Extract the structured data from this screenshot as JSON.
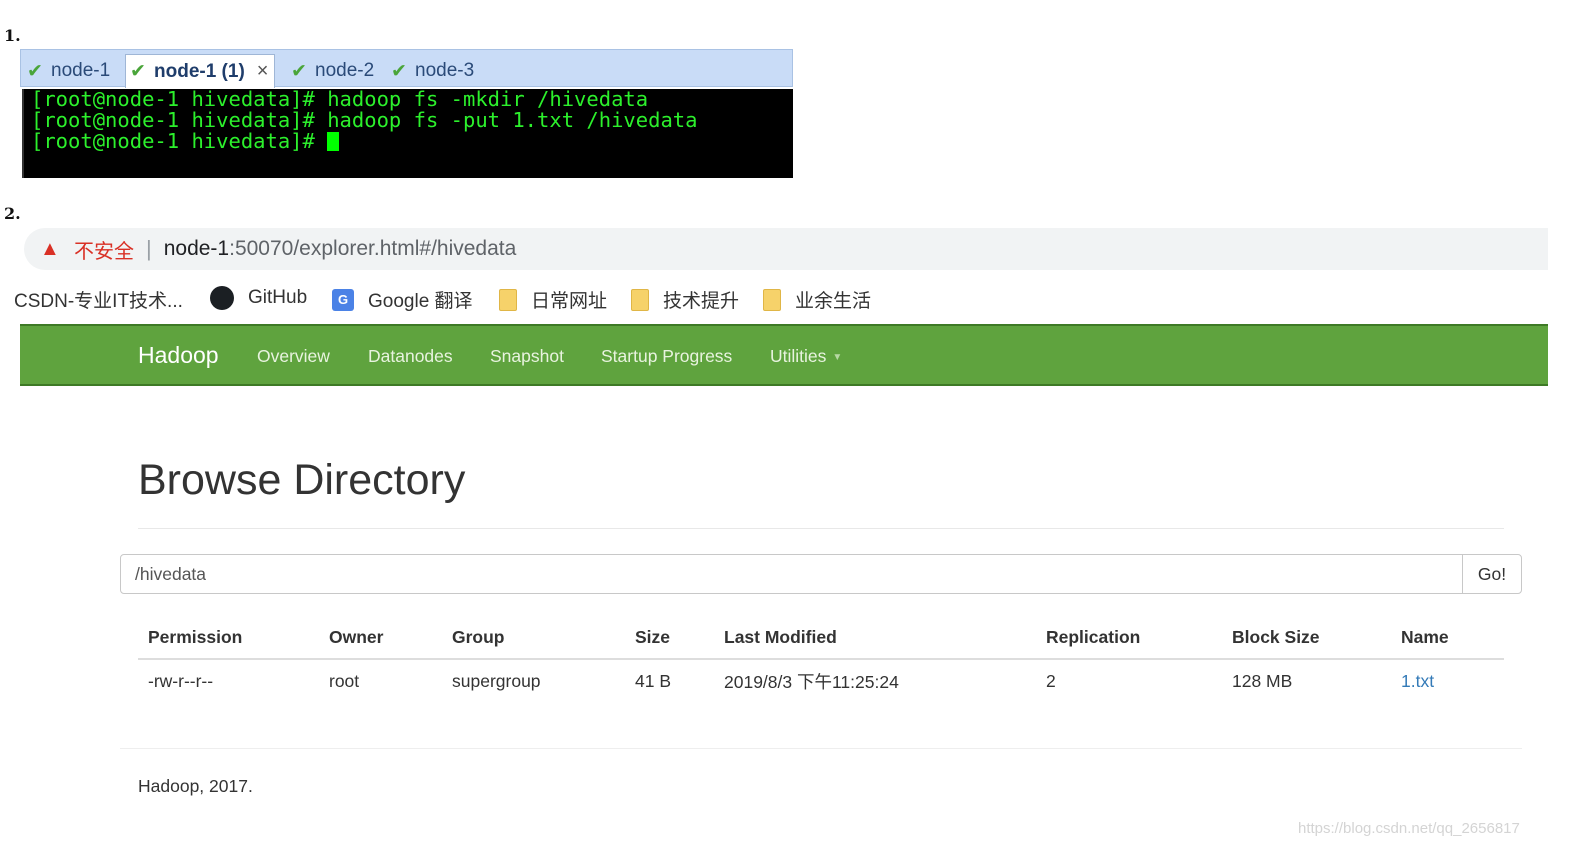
{
  "steps": {
    "one": "1.",
    "two": "2."
  },
  "terminal": {
    "tabs": [
      {
        "label": "node-1",
        "active": false
      },
      {
        "label": "node-1 (1)",
        "active": true,
        "close": "×"
      },
      {
        "label": "node-2",
        "active": false
      },
      {
        "label": "node-3",
        "active": false
      }
    ],
    "lines": [
      "[root@node-1 hivedata]# hadoop fs -mkdir /hivedata",
      "[root@node-1 hivedata]# hadoop fs -put 1.txt /hivedata",
      "[root@node-1 hivedata]# "
    ]
  },
  "browser": {
    "security_label": "不安全",
    "url_host": "node-1",
    "url_rest": ":50070/explorer.html#/hivedata",
    "bookmarks": [
      {
        "label": "CSDN-专业IT技术...",
        "icon": "none"
      },
      {
        "label": "GitHub",
        "icon": "github-icon"
      },
      {
        "label": "Google 翻译",
        "icon": "google-translate-icon"
      },
      {
        "label": "日常网址",
        "icon": "folder-icon"
      },
      {
        "label": "技术提升",
        "icon": "folder-icon"
      },
      {
        "label": "业余生活",
        "icon": "folder-icon"
      }
    ]
  },
  "hadoop": {
    "brand": "Hadoop",
    "nav": [
      "Overview",
      "Datanodes",
      "Snapshot",
      "Startup Progress",
      "Utilities"
    ],
    "colors": {
      "navbar": "#5fa33e",
      "link": "#337ab7"
    },
    "title": "Browse Directory",
    "path_value": "/hivedata",
    "go_label": "Go!",
    "table": {
      "headers": [
        "Permission",
        "Owner",
        "Group",
        "Size",
        "Last Modified",
        "Replication",
        "Block Size",
        "Name"
      ],
      "rows": [
        [
          "-rw-r--r--",
          "root",
          "supergroup",
          "41 B",
          "2019/8/3 下午11:25:24",
          "2",
          "128 MB",
          "1.txt"
        ]
      ]
    },
    "footer": "Hadoop, 2017."
  },
  "watermark": "https://blog.csdn.net/qq_2656817"
}
